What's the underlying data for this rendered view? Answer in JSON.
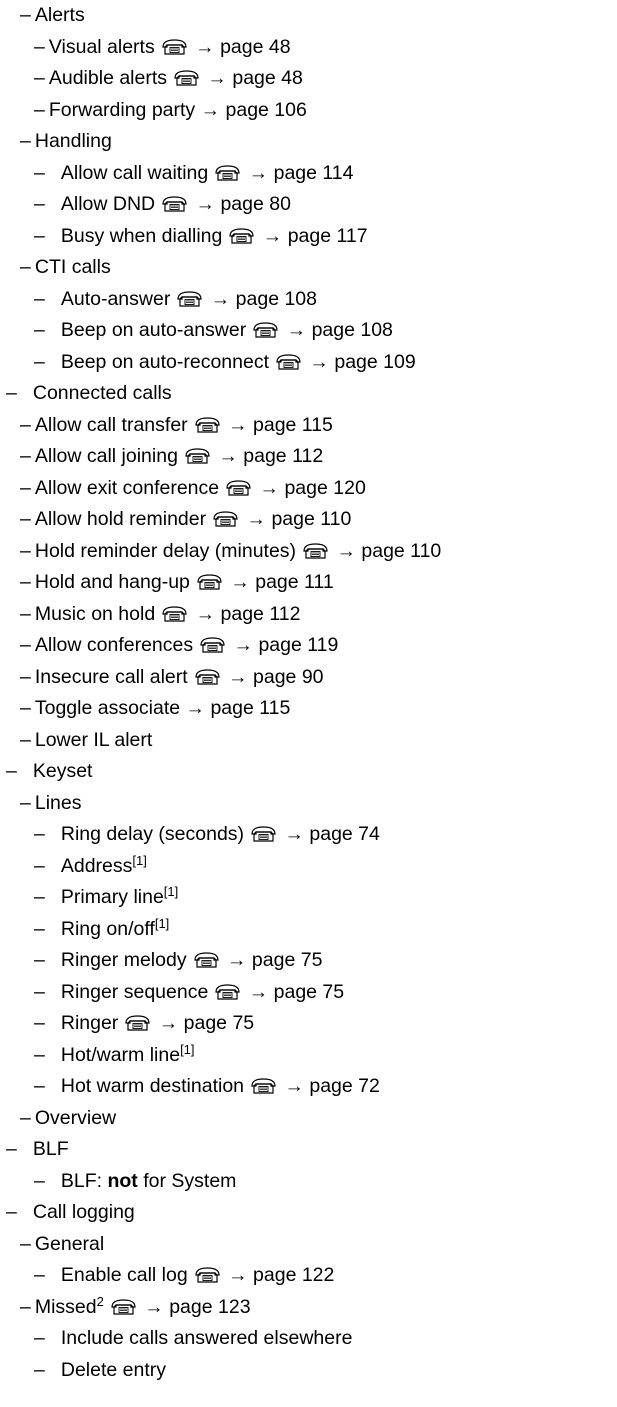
{
  "lines": [
    {
      "indent": 1,
      "dash": "–",
      "parts": [
        {
          "t": "Alerts"
        }
      ]
    },
    {
      "indent": 2,
      "dash": "–",
      "parts": [
        {
          "t": "Visual alerts"
        },
        {
          "icon": "phone-icon"
        },
        {
          "t": "→ page 48"
        }
      ]
    },
    {
      "indent": 2,
      "dash": "–",
      "parts": [
        {
          "t": "Audible alerts"
        },
        {
          "icon": "phone-icon"
        },
        {
          "t": "→ page 48"
        }
      ]
    },
    {
      "indent": 2,
      "dash": "–",
      "parts": [
        {
          "t": "Forwarding party → page 106"
        }
      ]
    },
    {
      "indent": 1,
      "dash": "–",
      "parts": [
        {
          "t": "Handling"
        }
      ]
    },
    {
      "indent": 2,
      "dash": "–",
      "parts": [
        {
          "t": "Allow call waiting"
        },
        {
          "icon": "phone-icon"
        },
        {
          "t": "→ page 114"
        }
      ]
    },
    {
      "indent": 2,
      "dash": "–",
      "parts": [
        {
          "t": "Allow DND"
        },
        {
          "icon": "phone-icon"
        },
        {
          "t": "→ page 80"
        }
      ]
    },
    {
      "indent": 2,
      "dash": "–",
      "parts": [
        {
          "t": "Busy when dialling"
        },
        {
          "icon": "phone-icon"
        },
        {
          "t": "→ page 117"
        }
      ]
    },
    {
      "indent": 1,
      "dash": "–",
      "parts": [
        {
          "t": "CTI calls"
        }
      ]
    },
    {
      "indent": 2,
      "dash": "–",
      "parts": [
        {
          "t": "Auto-answer"
        },
        {
          "icon": "phone-icon"
        },
        {
          "t": "→ page 108"
        }
      ]
    },
    {
      "indent": 2,
      "dash": "–",
      "parts": [
        {
          "t": "Beep on auto-answer"
        },
        {
          "icon": "phone-icon"
        },
        {
          "t": "→ page 108"
        }
      ]
    },
    {
      "indent": 2,
      "dash": "–",
      "parts": [
        {
          "t": "Beep on auto-reconnect"
        },
        {
          "icon": "phone-icon"
        },
        {
          "t": "→ page 109"
        }
      ]
    },
    {
      "indent": 0,
      "dash": "–",
      "parts": [
        {
          "t": "Connected calls"
        }
      ]
    },
    {
      "indent": 1,
      "dash": "–",
      "parts": [
        {
          "t": "Allow call transfer"
        },
        {
          "icon": "phone-icon"
        },
        {
          "t": "→ page 115"
        }
      ]
    },
    {
      "indent": 1,
      "dash": "–",
      "parts": [
        {
          "t": "Allow call joining"
        },
        {
          "icon": "phone-icon"
        },
        {
          "t": "→ page 112"
        }
      ]
    },
    {
      "indent": 1,
      "dash": "–",
      "parts": [
        {
          "t": "Allow exit conference"
        },
        {
          "icon": "phone-icon"
        },
        {
          "t": "→ page 120"
        }
      ]
    },
    {
      "indent": 1,
      "dash": "–",
      "parts": [
        {
          "t": "Allow hold reminder"
        },
        {
          "icon": "phone-icon"
        },
        {
          "t": "→ page 110"
        }
      ]
    },
    {
      "indent": 1,
      "dash": "–",
      "parts": [
        {
          "t": "Hold reminder delay (minutes)"
        },
        {
          "icon": "phone-icon"
        },
        {
          "t": "→ page 110"
        }
      ]
    },
    {
      "indent": 1,
      "dash": "–",
      "parts": [
        {
          "t": "Hold and hang-up"
        },
        {
          "icon": "phone-icon"
        },
        {
          "t": "→ page 111"
        }
      ]
    },
    {
      "indent": 1,
      "dash": "–",
      "parts": [
        {
          "t": "Music on hold"
        },
        {
          "icon": "phone-icon"
        },
        {
          "t": "→ page 112"
        }
      ]
    },
    {
      "indent": 1,
      "dash": "–",
      "parts": [
        {
          "t": "Allow conferences"
        },
        {
          "icon": "phone-icon"
        },
        {
          "t": "→ page 119"
        }
      ]
    },
    {
      "indent": 1,
      "dash": "–",
      "parts": [
        {
          "t": "Insecure call alert"
        },
        {
          "icon": "phone-icon"
        },
        {
          "t": "→ page 90"
        }
      ]
    },
    {
      "indent": 1,
      "dash": "–",
      "parts": [
        {
          "t": "Toggle associate → page 115"
        }
      ]
    },
    {
      "indent": 1,
      "dash": "–",
      "parts": [
        {
          "t": "Lower IL alert"
        }
      ]
    },
    {
      "indent": 0,
      "dash": "–",
      "parts": [
        {
          "t": "Keyset"
        }
      ]
    },
    {
      "indent": 1,
      "dash": "–",
      "parts": [
        {
          "t": "Lines"
        }
      ]
    },
    {
      "indent": 2,
      "dash": "–",
      "parts": [
        {
          "t": "Ring delay (seconds)"
        },
        {
          "icon": "phone-icon"
        },
        {
          "t": "→ page 74"
        }
      ]
    },
    {
      "indent": 2,
      "dash": "–",
      "parts": [
        {
          "t": "Address"
        },
        {
          "sup": "[1]"
        }
      ]
    },
    {
      "indent": 2,
      "dash": "–",
      "parts": [
        {
          "t": "Primary line"
        },
        {
          "sup": "[1]"
        }
      ]
    },
    {
      "indent": 2,
      "dash": "–",
      "parts": [
        {
          "t": "Ring on/off"
        },
        {
          "sup": "[1]"
        }
      ]
    },
    {
      "indent": 2,
      "dash": "–",
      "parts": [
        {
          "t": "Ringer melody"
        },
        {
          "icon": "phone-icon"
        },
        {
          "t": "→ page 75"
        }
      ]
    },
    {
      "indent": 2,
      "dash": "–",
      "parts": [
        {
          "t": "Ringer sequence"
        },
        {
          "icon": "phone-icon"
        },
        {
          "t": "→ page 75"
        }
      ]
    },
    {
      "indent": 2,
      "dash": "–",
      "parts": [
        {
          "t": "Ringer"
        },
        {
          "icon": "phone-icon"
        },
        {
          "t": "→ page 75"
        }
      ]
    },
    {
      "indent": 2,
      "dash": "–",
      "parts": [
        {
          "t": "Hot/warm line"
        },
        {
          "sup": "[1]"
        }
      ]
    },
    {
      "indent": 2,
      "dash": "–",
      "parts": [
        {
          "t": "Hot warm destination"
        },
        {
          "icon": "phone-icon"
        },
        {
          "t": "→ page 72"
        }
      ]
    },
    {
      "indent": 1,
      "dash": "–",
      "parts": [
        {
          "t": "Overview"
        }
      ]
    },
    {
      "indent": 0,
      "dash": "–",
      "parts": [
        {
          "t": "BLF"
        }
      ]
    },
    {
      "indent": 2,
      "dash": "–",
      "parts": [
        {
          "t": "BLF: "
        },
        {
          "b": "not"
        },
        {
          "t": " for System"
        }
      ]
    },
    {
      "indent": 0,
      "dash": "–",
      "parts": [
        {
          "t": "Call logging"
        }
      ]
    },
    {
      "indent": 1,
      "dash": "–",
      "parts": [
        {
          "t": "General"
        }
      ]
    },
    {
      "indent": 2,
      "dash": "–",
      "parts": [
        {
          "t": "Enable call log"
        },
        {
          "icon": "phone-icon"
        },
        {
          "t": "→ page 122"
        }
      ]
    },
    {
      "indent": 1,
      "dash": "–",
      "parts": [
        {
          "t": "Missed"
        },
        {
          "sup": "2"
        },
        {
          "icon": "phone-icon"
        },
        {
          "t": "→ page 123"
        }
      ]
    },
    {
      "indent": 2,
      "dash": "–",
      "parts": [
        {
          "t": "Include calls answered elsewhere"
        }
      ]
    },
    {
      "indent": 2,
      "dash": "–",
      "parts": [
        {
          "t": "Delete entry"
        }
      ]
    }
  ]
}
